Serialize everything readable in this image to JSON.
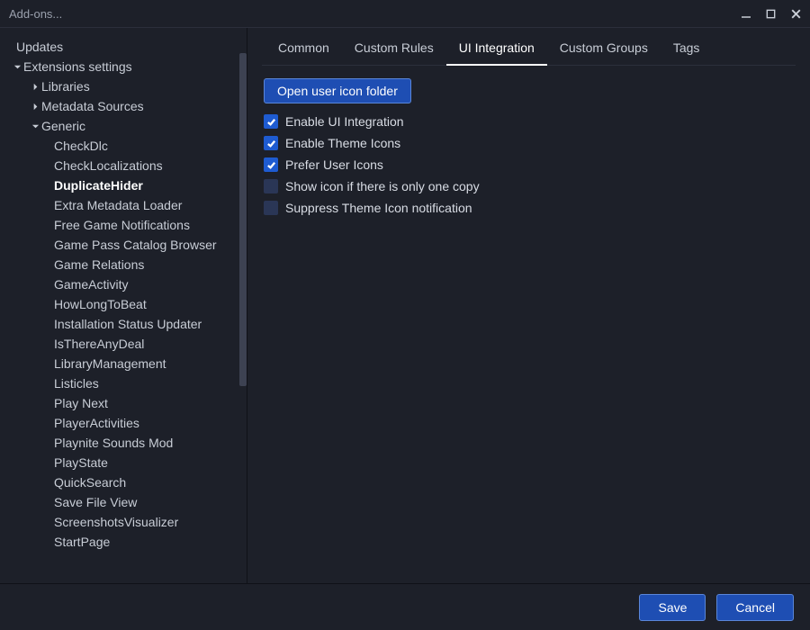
{
  "window": {
    "title": "Add-ons..."
  },
  "footer": {
    "save": "Save",
    "cancel": "Cancel"
  },
  "sidebar": {
    "updates": "Updates",
    "ext_settings": "Extensions settings",
    "libraries": "Libraries",
    "metadata_sources": "Metadata Sources",
    "generic": "Generic",
    "generic_items": [
      "CheckDlc",
      "CheckLocalizations",
      "DuplicateHider",
      "Extra Metadata Loader",
      "Free Game Notifications",
      "Game Pass Catalog Browser",
      "Game Relations",
      "GameActivity",
      "HowLongToBeat",
      "Installation Status Updater",
      "IsThereAnyDeal",
      "LibraryManagement",
      "Listicles",
      "Play Next",
      "PlayerActivities",
      "Playnite Sounds Mod",
      "PlayState",
      "QuickSearch",
      "Save File View",
      "ScreenshotsVisualizer",
      "StartPage"
    ],
    "selected_index": 2
  },
  "tabs": {
    "items": [
      "Common",
      "Custom Rules",
      "UI Integration",
      "Custom Groups",
      "Tags"
    ],
    "active_index": 2
  },
  "panel": {
    "open_folder_btn": "Open user icon folder",
    "checks": [
      {
        "label": "Enable UI Integration",
        "checked": true
      },
      {
        "label": "Enable Theme Icons",
        "checked": true
      },
      {
        "label": "Prefer User Icons",
        "checked": true
      },
      {
        "label": "Show icon if there is only one copy",
        "checked": false
      },
      {
        "label": "Suppress Theme Icon notification",
        "checked": false
      }
    ]
  }
}
